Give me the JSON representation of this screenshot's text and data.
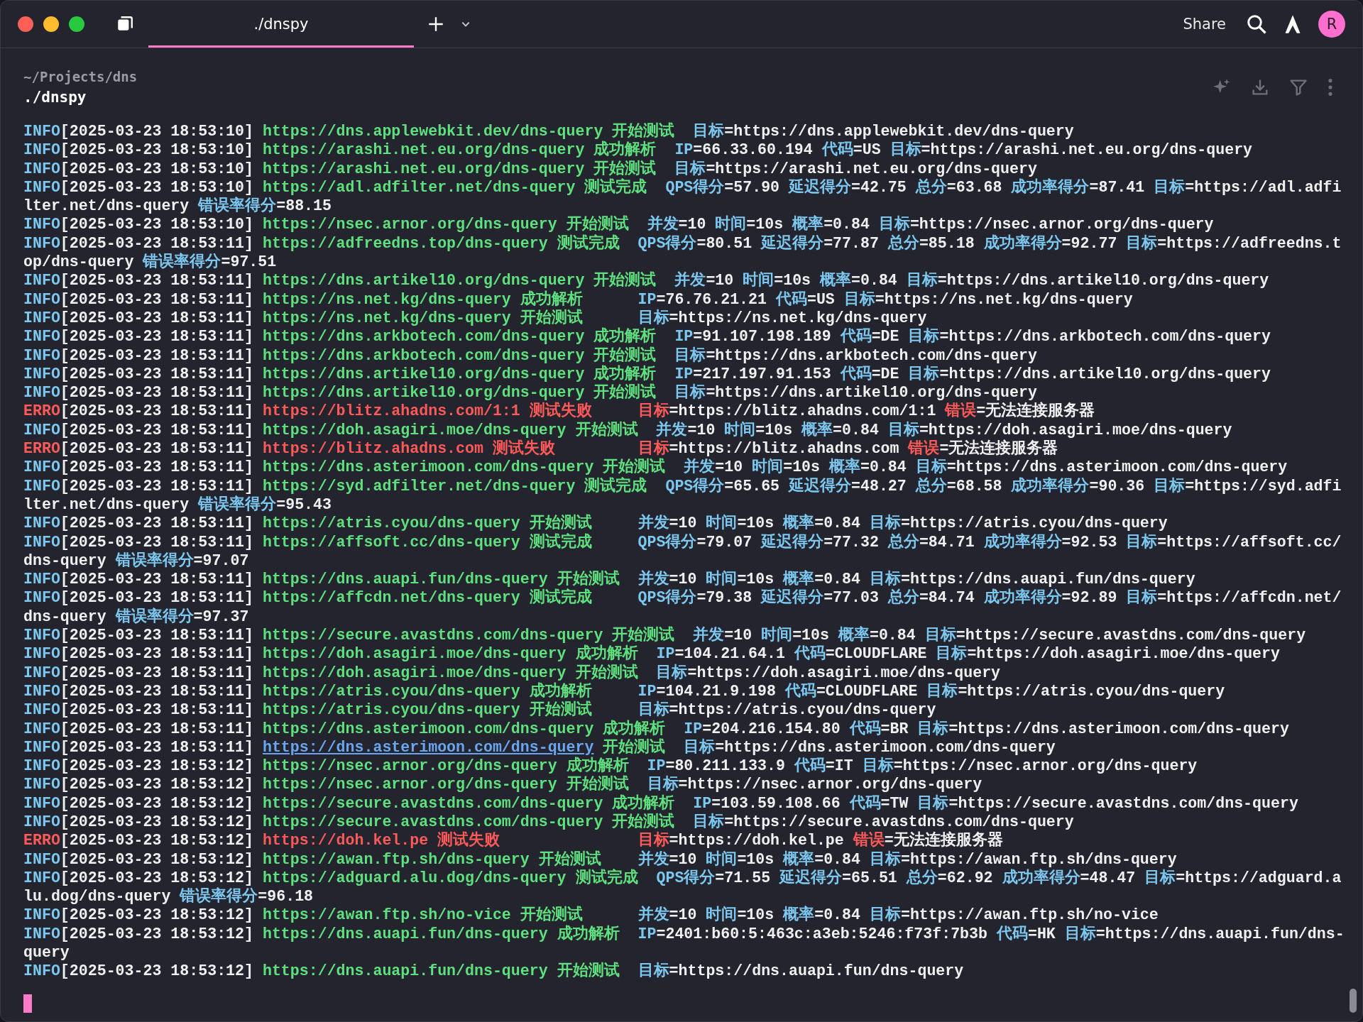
{
  "window": {
    "tabs": [
      {
        "label": "./dnspy",
        "selected": true
      }
    ],
    "share": "Share",
    "avatar": "R"
  },
  "block": {
    "cwd": "~/Projects/dns",
    "command": "./dnspy"
  },
  "log": [
    {
      "kind": "info",
      "level": "INFO",
      "time": "[2025-03-23 18:53:10]",
      "source": "https://dns.applewebkit.dev/dns-query",
      "message": "开始测试",
      "fields": [
        {
          "key": "目标",
          "value": "=https://dns.applewebkit.dev/dns-query"
        }
      ]
    },
    {
      "kind": "info",
      "level": "INFO",
      "time": "[2025-03-23 18:53:10]",
      "source": "https://arashi.net.eu.org/dns-query",
      "message": "成功解析",
      "fields": [
        {
          "key": "IP",
          "value": "=66.33.60.194"
        },
        {
          "key": "代码",
          "value": "=US"
        },
        {
          "key": "目标",
          "value": "=https://arashi.net.eu.org/dns-query"
        }
      ]
    },
    {
      "kind": "info",
      "level": "INFO",
      "time": "[2025-03-23 18:53:10]",
      "source": "https://arashi.net.eu.org/dns-query",
      "message": "开始测试",
      "fields": [
        {
          "key": "目标",
          "value": "=https://arashi.net.eu.org/dns-query"
        }
      ]
    },
    {
      "kind": "info",
      "level": "INFO",
      "time": "[2025-03-23 18:53:10]",
      "source": "https://adl.adfilter.net/dns-query",
      "message": "测试完成",
      "fields": [
        {
          "key": "QPS得分",
          "value": "=57.90"
        },
        {
          "key": "延迟得分",
          "value": "=42.75"
        },
        {
          "key": "总分",
          "value": "=63.68"
        },
        {
          "key": "成功率得分",
          "value": "=87.41"
        },
        {
          "key": "目标",
          "value": "=https://adl.adfilter.net/dns-query"
        },
        {
          "key": "错误率得分",
          "value": "=88.15"
        }
      ]
    },
    {
      "kind": "info",
      "level": "INFO",
      "time": "[2025-03-23 18:53:10]",
      "source": "https://nsec.arnor.org/dns-query",
      "message": "开始测试",
      "fields": [
        {
          "key": "并发",
          "value": "=10"
        },
        {
          "key": "时间",
          "value": "=10s"
        },
        {
          "key": "概率",
          "value": "=0.84"
        },
        {
          "key": "目标",
          "value": "=https://nsec.arnor.org/dns-query"
        }
      ]
    },
    {
      "kind": "info",
      "level": "INFO",
      "time": "[2025-03-23 18:53:11]",
      "source": "https://adfreedns.top/dns-query",
      "message": "测试完成",
      "fields": [
        {
          "key": "QPS得分",
          "value": "=80.51"
        },
        {
          "key": "延迟得分",
          "value": "=77.87"
        },
        {
          "key": "总分",
          "value": "=85.18"
        },
        {
          "key": "成功率得分",
          "value": "=92.77"
        },
        {
          "key": "目标",
          "value": "=https://adfreedns.top/dns-query"
        },
        {
          "key": "错误率得分",
          "value": "=97.51"
        }
      ]
    },
    {
      "kind": "info",
      "level": "INFO",
      "time": "[2025-03-23 18:53:11]",
      "source": "https://dns.artikel10.org/dns-query",
      "message": "开始测试",
      "fields": [
        {
          "key": "并发",
          "value": "=10"
        },
        {
          "key": "时间",
          "value": "=10s"
        },
        {
          "key": "概率",
          "value": "=0.84"
        },
        {
          "key": "目标",
          "value": "=https://dns.artikel10.org/dns-query"
        }
      ]
    },
    {
      "kind": "info",
      "level": "INFO",
      "time": "[2025-03-23 18:53:11]",
      "source": "https://ns.net.kg/dns-query",
      "message": "成功解析",
      "fields": [
        {
          "key": "IP",
          "value": "=76.76.21.21"
        },
        {
          "key": "代码",
          "value": "=US"
        },
        {
          "key": "目标",
          "value": "=https://ns.net.kg/dns-query"
        }
      ]
    },
    {
      "kind": "info",
      "level": "INFO",
      "time": "[2025-03-23 18:53:11]",
      "source": "https://ns.net.kg/dns-query",
      "message": "开始测试",
      "fields": [
        {
          "key": "目标",
          "value": "=https://ns.net.kg/dns-query"
        }
      ]
    },
    {
      "kind": "info",
      "level": "INFO",
      "time": "[2025-03-23 18:53:11]",
      "source": "https://dns.arkbotech.com/dns-query",
      "message": "成功解析",
      "fields": [
        {
          "key": "IP",
          "value": "=91.107.198.189"
        },
        {
          "key": "代码",
          "value": "=DE"
        },
        {
          "key": "目标",
          "value": "=https://dns.arkbotech.com/dns-query"
        }
      ]
    },
    {
      "kind": "info",
      "level": "INFO",
      "time": "[2025-03-23 18:53:11]",
      "source": "https://dns.arkbotech.com/dns-query",
      "message": "开始测试",
      "fields": [
        {
          "key": "目标",
          "value": "=https://dns.arkbotech.com/dns-query"
        }
      ]
    },
    {
      "kind": "info",
      "level": "INFO",
      "time": "[2025-03-23 18:53:11]",
      "source": "https://dns.artikel10.org/dns-query",
      "message": "成功解析",
      "fields": [
        {
          "key": "IP",
          "value": "=217.197.91.153"
        },
        {
          "key": "代码",
          "value": "=DE"
        },
        {
          "key": "目标",
          "value": "=https://dns.artikel10.org/dns-query"
        }
      ]
    },
    {
      "kind": "info",
      "level": "INFO",
      "time": "[2025-03-23 18:53:11]",
      "source": "https://dns.artikel10.org/dns-query",
      "message": "开始测试",
      "fields": [
        {
          "key": "目标",
          "value": "=https://dns.artikel10.org/dns-query"
        }
      ]
    },
    {
      "kind": "error",
      "level": "ERRO",
      "time": "[2025-03-23 18:53:11]",
      "source": "https://blitz.ahadns.com/1:1",
      "message": "测试失败",
      "fields": [
        {
          "key": "目标",
          "value": "=https://blitz.ahadns.com/1:1"
        },
        {
          "key": "错误",
          "value": "=无法连接服务器"
        }
      ]
    },
    {
      "kind": "info",
      "level": "INFO",
      "time": "[2025-03-23 18:53:11]",
      "source": "https://doh.asagiri.moe/dns-query",
      "message": "开始测试",
      "fields": [
        {
          "key": "并发",
          "value": "=10"
        },
        {
          "key": "时间",
          "value": "=10s"
        },
        {
          "key": "概率",
          "value": "=0.84"
        },
        {
          "key": "目标",
          "value": "=https://doh.asagiri.moe/dns-query"
        }
      ]
    },
    {
      "kind": "error",
      "level": "ERRO",
      "time": "[2025-03-23 18:53:11]",
      "source": "https://blitz.ahadns.com",
      "message": "测试失败",
      "fields": [
        {
          "key": "目标",
          "value": "=https://blitz.ahadns.com"
        },
        {
          "key": "错误",
          "value": "=无法连接服务器"
        }
      ]
    },
    {
      "kind": "info",
      "level": "INFO",
      "time": "[2025-03-23 18:53:11]",
      "source": "https://dns.asterimoon.com/dns-query",
      "message": "开始测试",
      "fields": [
        {
          "key": "并发",
          "value": "=10"
        },
        {
          "key": "时间",
          "value": "=10s"
        },
        {
          "key": "概率",
          "value": "=0.84"
        },
        {
          "key": "目标",
          "value": "=https://dns.asterimoon.com/dns-query"
        }
      ]
    },
    {
      "kind": "info",
      "level": "INFO",
      "time": "[2025-03-23 18:53:11]",
      "source": "https://syd.adfilter.net/dns-query",
      "message": "测试完成",
      "fields": [
        {
          "key": "QPS得分",
          "value": "=65.65"
        },
        {
          "key": "延迟得分",
          "value": "=48.27"
        },
        {
          "key": "总分",
          "value": "=68.58"
        },
        {
          "key": "成功率得分",
          "value": "=90.36"
        },
        {
          "key": "目标",
          "value": "=https://syd.adfilter.net/dns-query"
        },
        {
          "key": "错误率得分",
          "value": "=95.43"
        }
      ]
    },
    {
      "kind": "info",
      "level": "INFO",
      "time": "[2025-03-23 18:53:11]",
      "source": "https://atris.cyou/dns-query",
      "message": "开始测试",
      "fields": [
        {
          "key": "并发",
          "value": "=10"
        },
        {
          "key": "时间",
          "value": "=10s"
        },
        {
          "key": "概率",
          "value": "=0.84"
        },
        {
          "key": "目标",
          "value": "=https://atris.cyou/dns-query"
        }
      ]
    },
    {
      "kind": "info",
      "level": "INFO",
      "time": "[2025-03-23 18:53:11]",
      "source": "https://affsoft.cc/dns-query",
      "message": "测试完成",
      "fields": [
        {
          "key": "QPS得分",
          "value": "=79.07"
        },
        {
          "key": "延迟得分",
          "value": "=77.32"
        },
        {
          "key": "总分",
          "value": "=84.71"
        },
        {
          "key": "成功率得分",
          "value": "=92.53"
        },
        {
          "key": "目标",
          "value": "=https://affsoft.cc/dns-query"
        },
        {
          "key": "错误率得分",
          "value": "=97.07"
        }
      ]
    },
    {
      "kind": "info",
      "level": "INFO",
      "time": "[2025-03-23 18:53:11]",
      "source": "https://dns.auapi.fun/dns-query",
      "message": "开始测试",
      "fields": [
        {
          "key": "并发",
          "value": "=10"
        },
        {
          "key": "时间",
          "value": "=10s"
        },
        {
          "key": "概率",
          "value": "=0.84"
        },
        {
          "key": "目标",
          "value": "=https://dns.auapi.fun/dns-query"
        }
      ]
    },
    {
      "kind": "info",
      "level": "INFO",
      "time": "[2025-03-23 18:53:11]",
      "source": "https://affcdn.net/dns-query",
      "message": "测试完成",
      "fields": [
        {
          "key": "QPS得分",
          "value": "=79.38"
        },
        {
          "key": "延迟得分",
          "value": "=77.03"
        },
        {
          "key": "总分",
          "value": "=84.74"
        },
        {
          "key": "成功率得分",
          "value": "=92.89"
        },
        {
          "key": "目标",
          "value": "=https://affcdn.net/dns-query"
        },
        {
          "key": "错误率得分",
          "value": "=97.37"
        }
      ]
    },
    {
      "kind": "info",
      "level": "INFO",
      "time": "[2025-03-23 18:53:11]",
      "source": "https://secure.avastdns.com/dns-query",
      "message": "开始测试",
      "fields": [
        {
          "key": "并发",
          "value": "=10"
        },
        {
          "key": "时间",
          "value": "=10s"
        },
        {
          "key": "概率",
          "value": "=0.84"
        },
        {
          "key": "目标",
          "value": "=https://secure.avastdns.com/dns-query"
        }
      ]
    },
    {
      "kind": "info",
      "level": "INFO",
      "time": "[2025-03-23 18:53:11]",
      "source": "https://doh.asagiri.moe/dns-query",
      "message": "成功解析",
      "fields": [
        {
          "key": "IP",
          "value": "=104.21.64.1"
        },
        {
          "key": "代码",
          "value": "=CLOUDFLARE"
        },
        {
          "key": "目标",
          "value": "=https://doh.asagiri.moe/dns-query"
        }
      ]
    },
    {
      "kind": "info",
      "level": "INFO",
      "time": "[2025-03-23 18:53:11]",
      "source": "https://doh.asagiri.moe/dns-query",
      "message": "开始测试",
      "fields": [
        {
          "key": "目标",
          "value": "=https://doh.asagiri.moe/dns-query"
        }
      ]
    },
    {
      "kind": "info",
      "level": "INFO",
      "time": "[2025-03-23 18:53:11]",
      "source": "https://atris.cyou/dns-query",
      "message": "成功解析",
      "fields": [
        {
          "key": "IP",
          "value": "=104.21.9.198"
        },
        {
          "key": "代码",
          "value": "=CLOUDFLARE"
        },
        {
          "key": "目标",
          "value": "=https://atris.cyou/dns-query"
        }
      ]
    },
    {
      "kind": "info",
      "level": "INFO",
      "time": "[2025-03-23 18:53:11]",
      "source": "https://atris.cyou/dns-query",
      "message": "开始测试",
      "fields": [
        {
          "key": "目标",
          "value": "=https://atris.cyou/dns-query"
        }
      ]
    },
    {
      "kind": "info",
      "level": "INFO",
      "time": "[2025-03-23 18:53:11]",
      "source": "https://dns.asterimoon.com/dns-query",
      "message": "成功解析",
      "fields": [
        {
          "key": "IP",
          "value": "=204.216.154.80"
        },
        {
          "key": "代码",
          "value": "=BR"
        },
        {
          "key": "目标",
          "value": "=https://dns.asterimoon.com/dns-query"
        }
      ]
    },
    {
      "kind": "info",
      "level": "INFO",
      "time": "[2025-03-23 18:53:11]",
      "source": "https://dns.asterimoon.com/dns-query",
      "source_hovered": true,
      "message": "开始测试",
      "fields": [
        {
          "key": "目标",
          "value": "=https://dns.asterimoon.com/dns-query"
        }
      ]
    },
    {
      "kind": "info",
      "level": "INFO",
      "time": "[2025-03-23 18:53:12]",
      "source": "https://nsec.arnor.org/dns-query",
      "message": "成功解析",
      "fields": [
        {
          "key": "IP",
          "value": "=80.211.133.9"
        },
        {
          "key": "代码",
          "value": "=IT"
        },
        {
          "key": "目标",
          "value": "=https://nsec.arnor.org/dns-query"
        }
      ]
    },
    {
      "kind": "info",
      "level": "INFO",
      "time": "[2025-03-23 18:53:12]",
      "source": "https://nsec.arnor.org/dns-query",
      "message": "开始测试",
      "fields": [
        {
          "key": "目标",
          "value": "=https://nsec.arnor.org/dns-query"
        }
      ]
    },
    {
      "kind": "info",
      "level": "INFO",
      "time": "[2025-03-23 18:53:12]",
      "source": "https://secure.avastdns.com/dns-query",
      "message": "成功解析",
      "fields": [
        {
          "key": "IP",
          "value": "=103.59.108.66"
        },
        {
          "key": "代码",
          "value": "=TW"
        },
        {
          "key": "目标",
          "value": "=https://secure.avastdns.com/dns-query"
        }
      ]
    },
    {
      "kind": "info",
      "level": "INFO",
      "time": "[2025-03-23 18:53:12]",
      "source": "https://secure.avastdns.com/dns-query",
      "message": "开始测试",
      "fields": [
        {
          "key": "目标",
          "value": "=https://secure.avastdns.com/dns-query"
        }
      ]
    },
    {
      "kind": "error",
      "level": "ERRO",
      "time": "[2025-03-23 18:53:12]",
      "source": "https://doh.kel.pe",
      "message": "测试失败",
      "fields": [
        {
          "key": "目标",
          "value": "=https://doh.kel.pe"
        },
        {
          "key": "错误",
          "value": "=无法连接服务器"
        }
      ]
    },
    {
      "kind": "info",
      "level": "INFO",
      "time": "[2025-03-23 18:53:12]",
      "source": "https://awan.ftp.sh/dns-query",
      "message": "开始测试",
      "fields": [
        {
          "key": "并发",
          "value": "=10"
        },
        {
          "key": "时间",
          "value": "=10s"
        },
        {
          "key": "概率",
          "value": "=0.84"
        },
        {
          "key": "目标",
          "value": "=https://awan.ftp.sh/dns-query"
        }
      ]
    },
    {
      "kind": "info",
      "level": "INFO",
      "time": "[2025-03-23 18:53:12]",
      "source": "https://adguard.alu.dog/dns-query",
      "message": "测试完成",
      "fields": [
        {
          "key": "QPS得分",
          "value": "=71.55"
        },
        {
          "key": "延迟得分",
          "value": "=65.51"
        },
        {
          "key": "总分",
          "value": "=62.92"
        },
        {
          "key": "成功率得分",
          "value": "=48.47"
        },
        {
          "key": "目标",
          "value": "=https://adguard.alu.dog/dns-query"
        },
        {
          "key": "错误率得分",
          "value": "=96.18"
        }
      ]
    },
    {
      "kind": "info",
      "level": "INFO",
      "time": "[2025-03-23 18:53:12]",
      "source": "https://awan.ftp.sh/no-vice",
      "message": "开始测试",
      "fields": [
        {
          "key": "并发",
          "value": "=10"
        },
        {
          "key": "时间",
          "value": "=10s"
        },
        {
          "key": "概率",
          "value": "=0.84"
        },
        {
          "key": "目标",
          "value": "=https://awan.ftp.sh/no-vice"
        }
      ]
    },
    {
      "kind": "info",
      "level": "INFO",
      "time": "[2025-03-23 18:53:12]",
      "source": "https://dns.auapi.fun/dns-query",
      "message": "成功解析",
      "fields": [
        {
          "key": "IP",
          "value": "=2401:b60:5:463c:a3eb:5246:f73f:7b3b"
        },
        {
          "key": "代码",
          "value": "=HK"
        },
        {
          "key": "目标",
          "value": "=https://dns.auapi.fun/dns-query"
        }
      ]
    },
    {
      "kind": "info",
      "level": "INFO",
      "time": "[2025-03-23 18:53:12]",
      "source": "https://dns.auapi.fun/dns-query",
      "message": "开始测试",
      "fields": [
        {
          "key": "目标",
          "value": "=https://dns.auapi.fun/dns-query"
        }
      ]
    }
  ]
}
